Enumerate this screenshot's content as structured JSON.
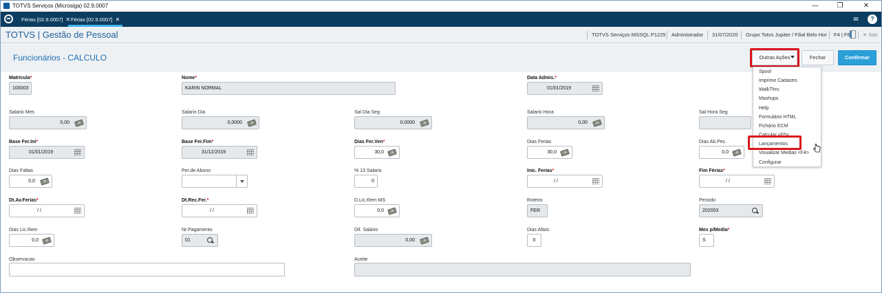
{
  "window": {
    "title": "TOTVS Serviços (Microsiga) 02.9.0007",
    "minimize": "—",
    "restore": "❐",
    "close": "✕"
  },
  "tabs": [
    {
      "label": "Férias [02.9.0007]",
      "close": "✕"
    },
    {
      "label": "Férias [02.9.0007]",
      "close": "✕"
    }
  ],
  "header": {
    "app_title": "TOTVS | Gestão de Pessoal",
    "environment": "TOTVS Serviços MSSQL P1225",
    "user": "Administrador",
    "date": "31/07/2020",
    "branch": "Grupo Totvs Jupiter / Filial Belo Hor",
    "keys": "F4 | F6",
    "logout": "Sair"
  },
  "page": {
    "title": "Funcionários - CALCULO",
    "btn_other_actions": "Outras Ações",
    "btn_close": "Fechar",
    "btn_confirm": "Confirmar"
  },
  "menu": [
    "Spool",
    "Imprime Cadastro",
    "WalkThru",
    "Mashups",
    "Help",
    "Formulário HTML",
    "Fichário ECM",
    "Calcular <F5>",
    "Lançamentos",
    "Visualizar Medias <F4>",
    "Configurar"
  ],
  "fields": {
    "matricula": {
      "label": "Matricula",
      "value": "100003"
    },
    "nome": {
      "label": "Nome",
      "value": "KARIN NORMAL"
    },
    "data_admis": {
      "label": "Data Admis.",
      "value": "01/01/2019"
    },
    "salario_mes": {
      "label": "Salario Mes",
      "value": "0,00"
    },
    "salario_dia": {
      "label": "Salario Dia",
      "value": "0,0000"
    },
    "sal_dia_seg": {
      "label": "Sal Dia Seg",
      "value": "0,0000"
    },
    "salario_hora": {
      "label": "Salario Hora",
      "value": "0,00"
    },
    "sal_hora_seg": {
      "label": "Sal Hora Seg",
      "value": ""
    },
    "base_fer_ini": {
      "label": "Base Fer.Ini",
      "value": "01/01/2019"
    },
    "base_fer_fim": {
      "label": "Base Fer.Fim",
      "value": "31/12/2019"
    },
    "dias_fer_ven": {
      "label": "Dias Fer.Ven",
      "value": "30,0"
    },
    "dias_ferias": {
      "label": "Dias Ferias",
      "value": "30,0"
    },
    "dias_ab_pec": {
      "label": "Dias Ab.Pec.",
      "value": "0,0"
    },
    "dias_faltas": {
      "label": "Dias Faltas",
      "value": "0,0"
    },
    "per_abono": {
      "label": "Per.de Abono",
      "value": ""
    },
    "pct_13_salario": {
      "label": "% 13 Salario",
      "value": "0"
    },
    "inic_ferias": {
      "label": "Inic. Ferias",
      "value": "/ /"
    },
    "fim_ferias": {
      "label": "Fim Férias",
      "value": "/ /"
    },
    "dt_av_ferias": {
      "label": "Dt.Av.Ferias",
      "value": "/ /"
    },
    "dt_rec_fer": {
      "label": "Dt.Rec.Fer.",
      "value": "/ /"
    },
    "d_lic_rem_ms": {
      "label": "D.Lic.Rem MS",
      "value": "0,0"
    },
    "roteiro": {
      "label": "Roteiro",
      "value": "FER"
    },
    "periodo": {
      "label": "Periodo",
      "value": "202003"
    },
    "dias_lic_rem": {
      "label": "Dias Lic.Rem",
      "value": "0,0"
    },
    "nr_pagamento": {
      "label": "Nr.Pagamento",
      "value": "01"
    },
    "dif_salario": {
      "label": "Dif. Salário",
      "value": "0,00"
    },
    "dias_afast": {
      "label": "Dias Afast.",
      "value": "0"
    },
    "mes_p_media": {
      "label": "Mes p/Media",
      "value": "S"
    },
    "observacao": {
      "label": "Observacao",
      "value": ""
    },
    "aceite": {
      "label": "Aceite",
      "value": ""
    }
  },
  "required_mark": "*",
  "colors": {
    "accent": "#1f6fb2",
    "topbar": "#0c3c60",
    "highlight": "#d9141c",
    "primary_button": "#2b9fd8"
  }
}
